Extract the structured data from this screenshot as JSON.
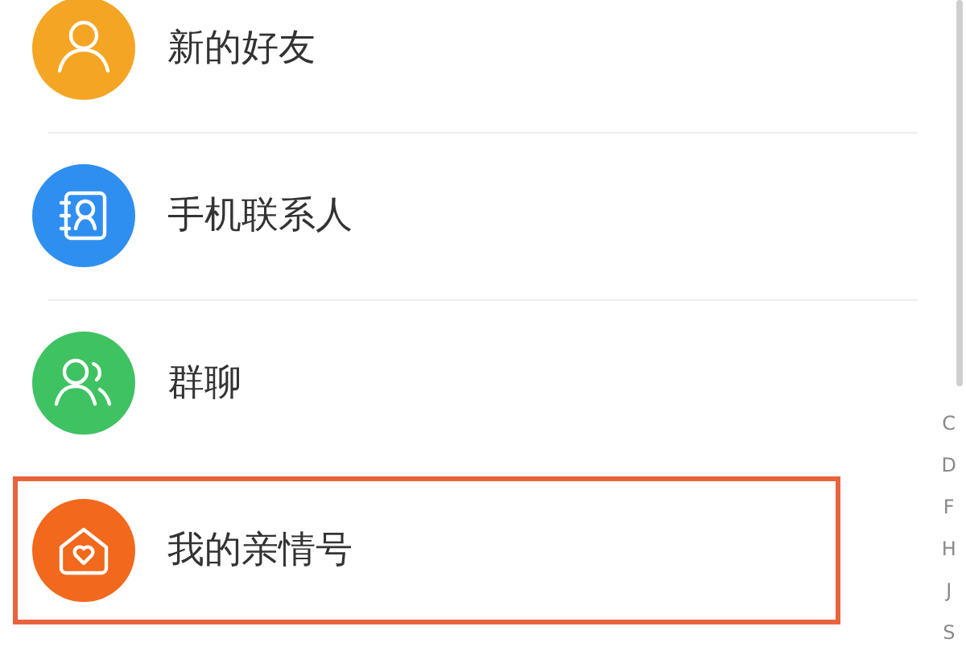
{
  "entries": [
    {
      "kind": "new-friends",
      "label": "新的好友",
      "color": "#f5a524",
      "highlighted": false
    },
    {
      "kind": "phone-contacts",
      "label": "手机联系人",
      "color": "#2f8ff0",
      "highlighted": false
    },
    {
      "kind": "group-chat",
      "label": "群聊",
      "color": "#3fc261",
      "highlighted": false
    },
    {
      "kind": "family",
      "label": "我的亲情号",
      "color": "#f2681c",
      "highlighted": true
    }
  ],
  "index": [
    "C",
    "D",
    "F",
    "H",
    "J",
    "S"
  ]
}
